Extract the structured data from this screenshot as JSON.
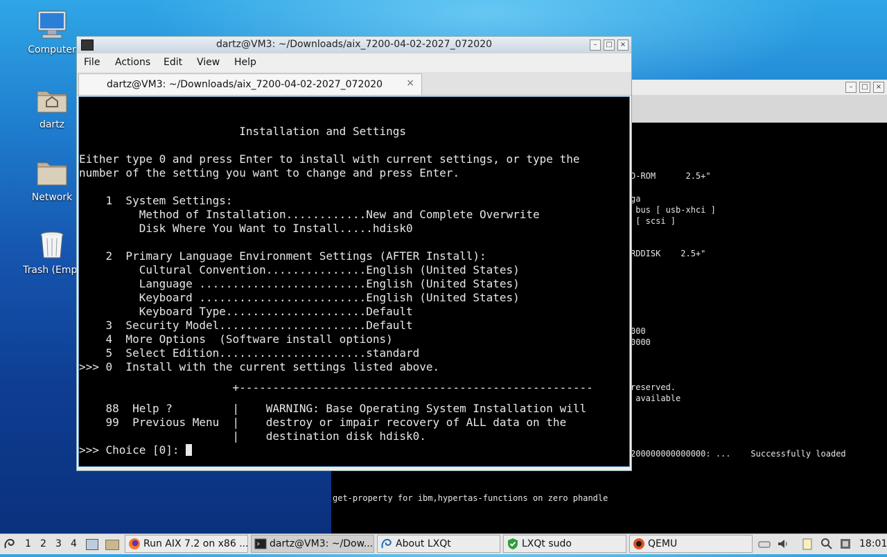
{
  "desktop_icons": [
    {
      "label": "Computer",
      "icon": "computer-icon"
    },
    {
      "label": "dartz",
      "icon": "home-folder-icon"
    },
    {
      "label": "Network",
      "icon": "folder-icon"
    },
    {
      "label": "Trash (Empt",
      "icon": "trash-icon"
    }
  ],
  "background_window": {
    "lines": [
      "D-ROM      2.5+\"",
      "ga",
      " bus [ usb-xhci ]",
      " [ scsi ]",
      "RDDISK    2.5+\"",
      "000",
      "0000",
      "reserved.",
      " available",
      "200000000000000: ...    Successfully loaded",
      "get-property for ibm,hypertas-functions on zero phandle"
    ]
  },
  "terminal": {
    "window_title": "dartz@VM3: ~/Downloads/aix_7200-04-02-2027_072020",
    "menu": [
      "File",
      "Actions",
      "Edit",
      "View",
      "Help"
    ],
    "tab_title": "dartz@VM3: ~/Downloads/aix_7200-04-02-2027_072020",
    "tab_close": "×",
    "lines": [
      "                        Installation and Settings",
      "Either type 0 and press Enter to install with current settings, or type the",
      "number of the setting you want to change and press Enter.",
      "    1  System Settings:",
      "         Method of Installation............New and Complete Overwrite",
      "         Disk Where You Want to Install.....hdisk0",
      "    2  Primary Language Environment Settings (AFTER Install):",
      "         Cultural Convention...............English (United States)",
      "         Language .........................English (United States)",
      "         Keyboard .........................English (United States)",
      "         Keyboard Type.....................Default",
      "    3  Security Model......................Default",
      "    4  More Options  (Software install options)",
      "    5  Select Edition......................standard",
      ">>> 0  Install with the current settings listed above.",
      "                       +-----------------------------------------------------",
      "    88  Help ?         |    WARNING: Base Operating System Installation will",
      "    99  Previous Menu  |    destroy or impair recovery of ALL data on the",
      "                       |    destination disk hdisk0.",
      ">>> Choice [0]: "
    ]
  },
  "taskbar": {
    "desktops": [
      "1",
      "2",
      "3",
      "4"
    ],
    "tasks": [
      {
        "label": "Run AIX 7.2 on x86 ...",
        "icon": "firefox-icon"
      },
      {
        "label": "dartz@VM3: ~/Dow...",
        "icon": "terminal-icon"
      },
      {
        "label": "About LXQt",
        "icon": "lxqt-icon"
      },
      {
        "label": "LXQt sudo",
        "icon": "shield-check-icon"
      },
      {
        "label": "QEMU",
        "icon": "qemu-icon"
      }
    ],
    "clock": "18:01"
  }
}
